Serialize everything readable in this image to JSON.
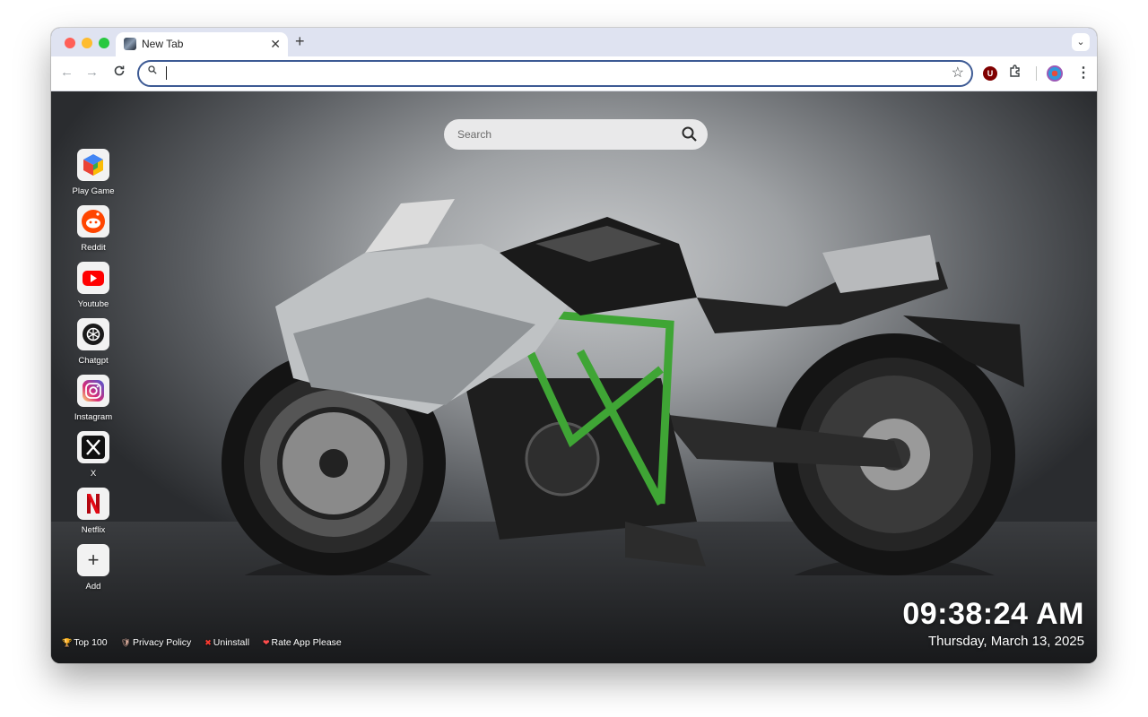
{
  "browser": {
    "tab_title": "New Tab",
    "tab_close": "✕",
    "new_tab": "+",
    "tab_list": "⌄",
    "back": "←",
    "forward": "→",
    "reload": "C",
    "omnibox_icon": "⚲",
    "omnibox_value": "",
    "bookmark_icon": "☆",
    "extension_badge": "U",
    "extensions_icon": "⧉",
    "menu_icon": "⋮"
  },
  "page": {
    "search_placeholder": "Search",
    "shortcuts": [
      {
        "label": "Play Game",
        "icon": "cube-icon"
      },
      {
        "label": "Reddit",
        "icon": "reddit-icon"
      },
      {
        "label": "Youtube",
        "icon": "youtube-icon"
      },
      {
        "label": "Chatgpt",
        "icon": "chatgpt-icon"
      },
      {
        "label": "Instagram",
        "icon": "instagram-icon"
      },
      {
        "label": "X",
        "icon": "x-icon"
      },
      {
        "label": "Netflix",
        "icon": "netflix-icon"
      },
      {
        "label": "Add",
        "icon": "plus-icon"
      }
    ],
    "add_symbol": "+",
    "netflix_letter": "N",
    "x_letter": "𝕏",
    "clock_time": "09:38:24 AM",
    "clock_date": "Thursday, March 13, 2025",
    "footer_links": [
      {
        "label": "Top 100",
        "icon": "🏆"
      },
      {
        "label": "Privacy Policy",
        "icon": "🛡"
      },
      {
        "label": "Uninstall",
        "icon": "✖"
      },
      {
        "label": "Rate App Please",
        "icon": "❤"
      }
    ]
  },
  "colors": {
    "youtube": "#ff0000",
    "reddit": "#ff4500",
    "netflix": "#e50914",
    "frame_green": "#3fa535",
    "omnibox_border": "#3d5a94"
  }
}
